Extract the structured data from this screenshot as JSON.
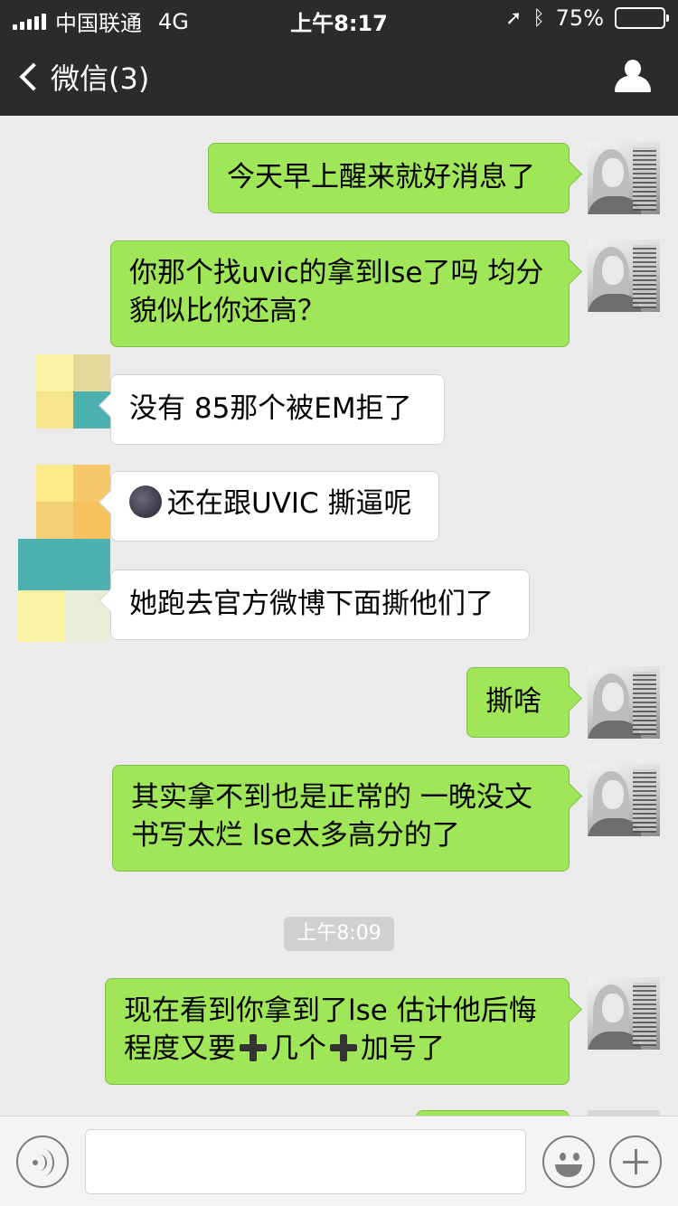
{
  "status_bar": {
    "carrier": "中国联通",
    "network": "4G",
    "time": "上午8:17",
    "battery": "75%",
    "battery_level": 0.75
  },
  "nav": {
    "back_label": "微信(3)",
    "profile_icon": "person-icon"
  },
  "messages": [
    {
      "side": "me",
      "lines": [
        "今天早上醒来就好消息了"
      ]
    },
    {
      "side": "me",
      "lines": [
        "你那个找uvic的拿到lse了吗 均分",
        "貌似比你还高？"
      ]
    },
    {
      "side": "other",
      "lines": [
        "没有 85那个被EM拒了"
      ]
    },
    {
      "side": "other",
      "emoji": "new-moon-face-icon",
      "lines": [
        "还在跟UVIC 撕逼呢"
      ]
    },
    {
      "side": "other",
      "lines": [
        "她跑去官方微博下面撕他们了"
      ]
    },
    {
      "side": "me",
      "lines": [
        "撕啥"
      ]
    },
    {
      "side": "me",
      "lines": [
        "其实拿不到也是正常的 一晚没文",
        "书写太烂 lse太多高分的了"
      ]
    },
    {
      "side": "me",
      "lines": [
        "现在看到你拿到了lse 估计他后悔",
        "程度又要",
        "几个",
        "加号了"
      ]
    }
  ],
  "timestamp": "上午8:09",
  "input_bar": {
    "voice_icon": "voice-icon",
    "text_value": "",
    "emoji_icon": "smiley-icon",
    "more_icon": "plus-icon"
  }
}
